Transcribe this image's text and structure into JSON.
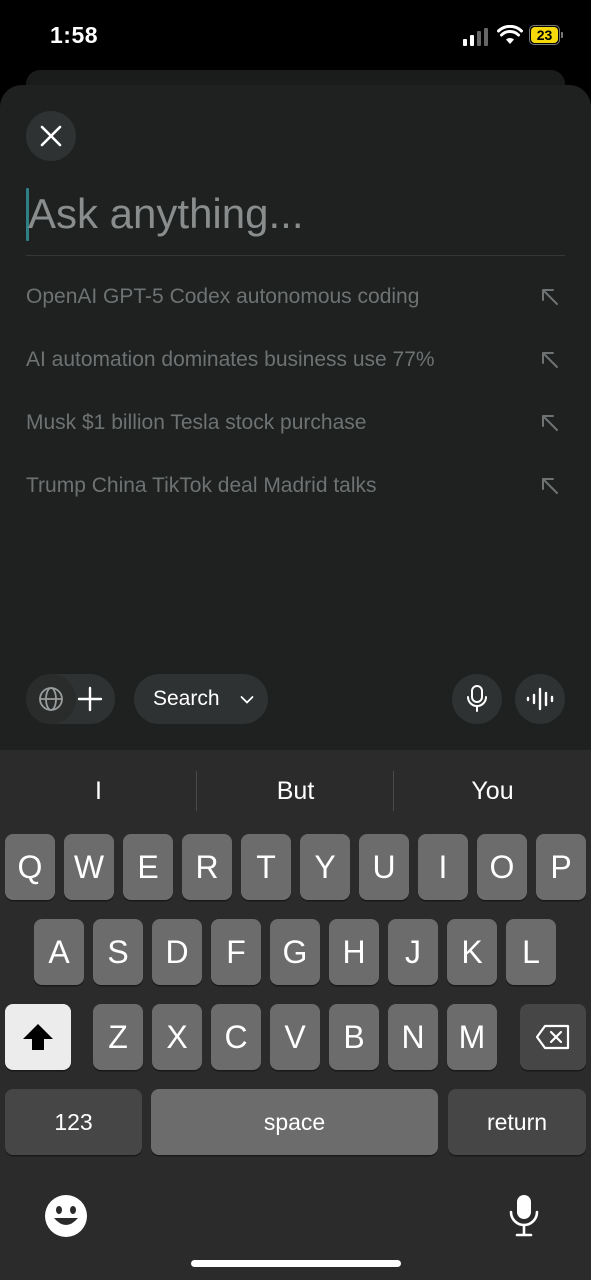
{
  "status_bar": {
    "time": "1:58",
    "battery": "23"
  },
  "compose": {
    "placeholder": "Ask anything...",
    "suggestions": [
      {
        "text": "OpenAI GPT-5 Codex autonomous coding"
      },
      {
        "text": "AI automation dominates business use 77%"
      },
      {
        "text": "Musk $1 billion Tesla stock purchase"
      },
      {
        "text": "Trump China TikTok deal Madrid talks"
      }
    ],
    "toolbar": {
      "search_label": "Search"
    }
  },
  "keyboard": {
    "predictions": [
      "I",
      "But",
      "You"
    ],
    "row1": [
      "Q",
      "W",
      "E",
      "R",
      "T",
      "Y",
      "U",
      "I",
      "O",
      "P"
    ],
    "row2": [
      "A",
      "S",
      "D",
      "F",
      "G",
      "H",
      "J",
      "K",
      "L"
    ],
    "row3": [
      "Z",
      "X",
      "C",
      "V",
      "B",
      "N",
      "M"
    ],
    "numbers_label": "123",
    "space_label": "space",
    "return_label": "return"
  },
  "colors": {
    "accent": "#2f7f87",
    "battery": "#f5d90a",
    "sheet": "#1f2121"
  }
}
